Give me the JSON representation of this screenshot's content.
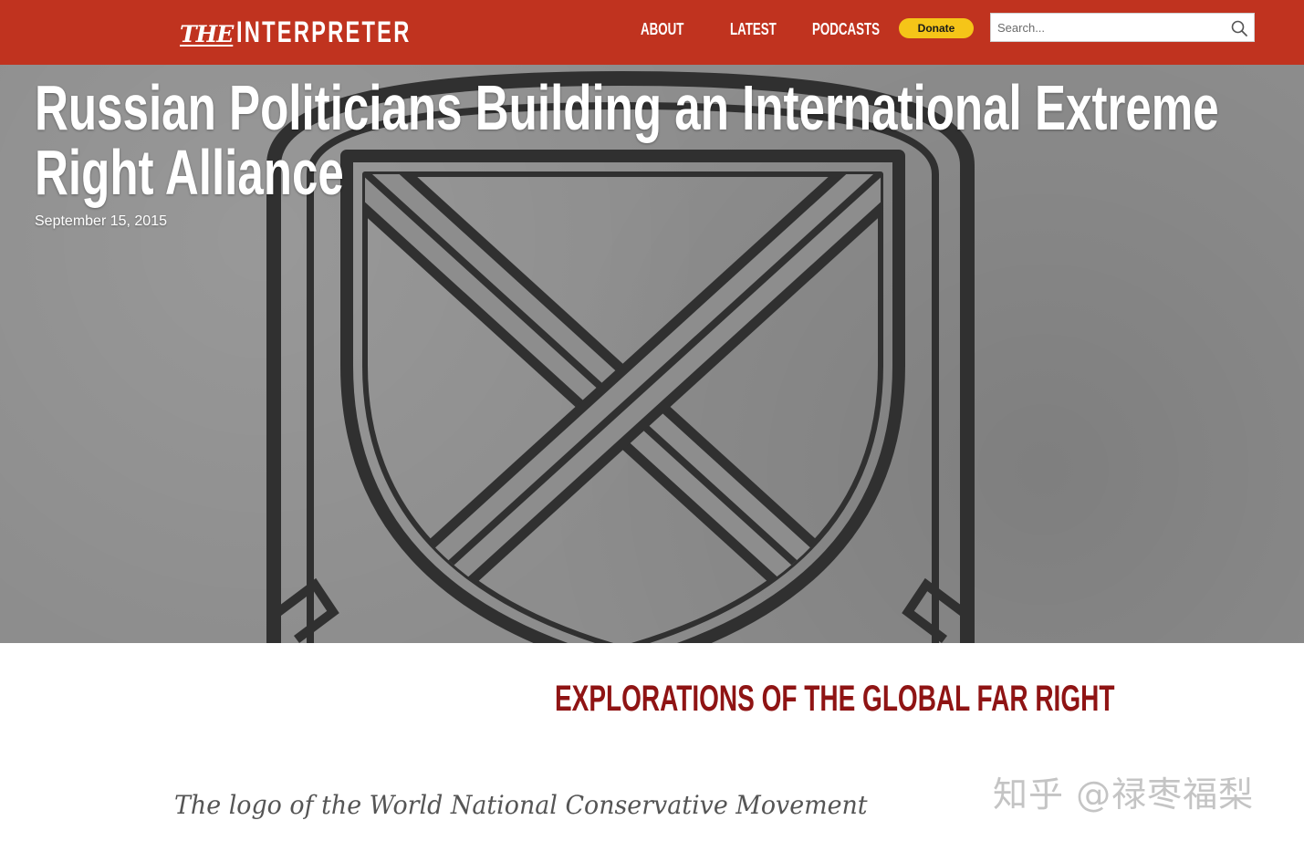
{
  "header": {
    "logo": {
      "the": "THE",
      "name": "INTERPRETER"
    },
    "nav": [
      {
        "label": "ABOUT"
      },
      {
        "label": "LATEST"
      },
      {
        "label": "PODCASTS"
      }
    ],
    "donate_label": "Donate",
    "search": {
      "placeholder": "Search...",
      "value": "",
      "icon": "magnifier-icon"
    },
    "colors": {
      "bar": "#c0331f",
      "donate": "#f5c518"
    }
  },
  "hero": {
    "title": "Russian Politicians Building an International Extreme Right Alliance",
    "date": "September 15, 2015",
    "image_icon": "shield-with-crossed-bars-emblem"
  },
  "article": {
    "section_heading": "EXPLORATIONS OF THE GLOBAL FAR RIGHT",
    "caption": "The logo of the World National Conservative Movement",
    "colors": {
      "heading": "#8f1414"
    }
  },
  "watermark": "知乎 @禄枣福梨"
}
